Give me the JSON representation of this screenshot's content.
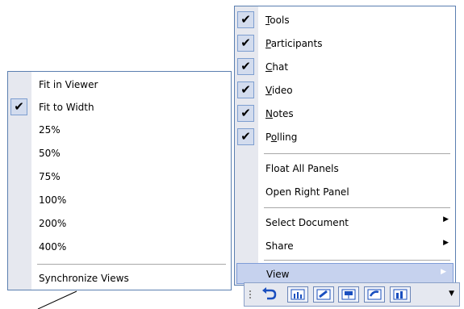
{
  "left_menu": {
    "items": [
      {
        "label": "Fit in Viewer",
        "checked": false
      },
      {
        "label": "Fit to Width",
        "checked": true
      },
      {
        "label": "25%",
        "checked": false
      },
      {
        "label": "50%",
        "checked": false
      },
      {
        "label": "75%",
        "checked": false
      },
      {
        "label": "100%",
        "checked": false
      },
      {
        "label": "200%",
        "checked": false
      },
      {
        "label": "400%",
        "checked": false
      }
    ],
    "sync_label": "Synchronize Views"
  },
  "right_menu": {
    "panels": [
      {
        "accel": "T",
        "rest": "ools",
        "checked": true
      },
      {
        "accel": "P",
        "rest": "articipants",
        "checked": true
      },
      {
        "accel": "C",
        "rest": "hat",
        "checked": true
      },
      {
        "accel": "V",
        "rest": "ideo",
        "checked": true
      },
      {
        "accel": "N",
        "rest": "otes",
        "checked": true
      },
      {
        "pre": "P",
        "accel": "o",
        "rest": "lling",
        "checked": true
      }
    ],
    "float_all_label": "Float All Panels",
    "open_right_label": "Open Right Panel",
    "select_document_label": "Select Document",
    "share_label": "Share",
    "view_label": "View"
  },
  "toolbar": {
    "icons": [
      "undo-icon",
      "chart-icon",
      "whiteboard-icon",
      "presentation-icon",
      "annotate-icon",
      "bar-chart-icon"
    ],
    "dropdown_icon": "chevron-down-icon"
  },
  "colors": {
    "border": "#5b7fb0",
    "gutter": "#e6e8ef",
    "highlight": "#c6d2ee",
    "check_bg": "#d3dcee"
  }
}
